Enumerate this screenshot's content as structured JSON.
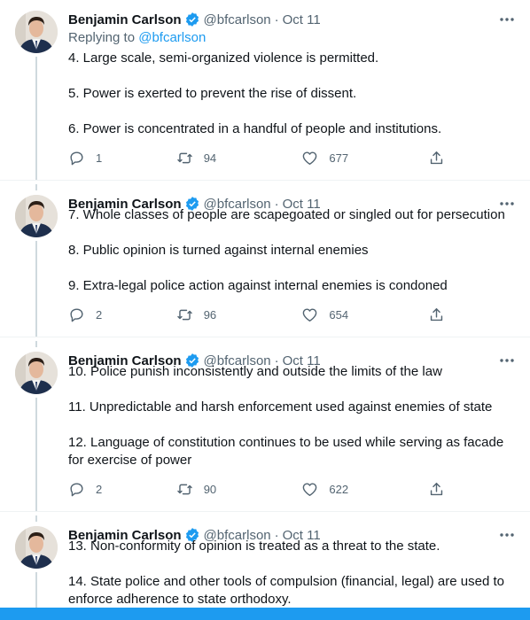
{
  "author": {
    "name": "Benjamin Carlson",
    "handle": "@bfcarlson",
    "date": "Oct 11",
    "verified": true
  },
  "replying": {
    "prefix": "Replying to ",
    "handle": "@bfcarlson"
  },
  "tweets": [
    {
      "paragraphs": [
        "4. Large scale, semi-organized violence is permitted.",
        "5. Power is exerted to prevent the rise of dissent.",
        "6. Power is concentrated in a handful of people and institutions."
      ],
      "replies": "1",
      "retweets": "94",
      "likes": "677"
    },
    {
      "paragraphs": [
        "7. Whole classes of people are scapegoated or singled out for persecution",
        "8. Public opinion is turned against internal enemies",
        "9. Extra-legal police action against internal enemies is condoned"
      ],
      "replies": "2",
      "retweets": "96",
      "likes": "654"
    },
    {
      "paragraphs": [
        "10. Police punish inconsistently and outside the limits of the law",
        "11. Unpredictable and harsh enforcement used against enemies of state",
        "12. Language of constitution continues to be used while serving as facade for exercise of power"
      ],
      "replies": "2",
      "retweets": "90",
      "likes": "622"
    },
    {
      "paragraphs": [
        "13. Non-conformity of opinion is treated as a threat to the state.",
        "14. State police and other tools of compulsion (financial, legal) are used to enforce adherence to state orthodoxy."
      ]
    }
  ],
  "icons": {
    "verified": "verified-badge-icon",
    "more": "more-horizontal-icon",
    "reply": "reply-icon",
    "retweet": "retweet-icon",
    "like": "heart-icon",
    "share": "share-icon"
  },
  "colors": {
    "accent": "#1d9bf0",
    "text": "#0f1419",
    "secondary": "#536471",
    "thread_line": "#cfd9de"
  }
}
